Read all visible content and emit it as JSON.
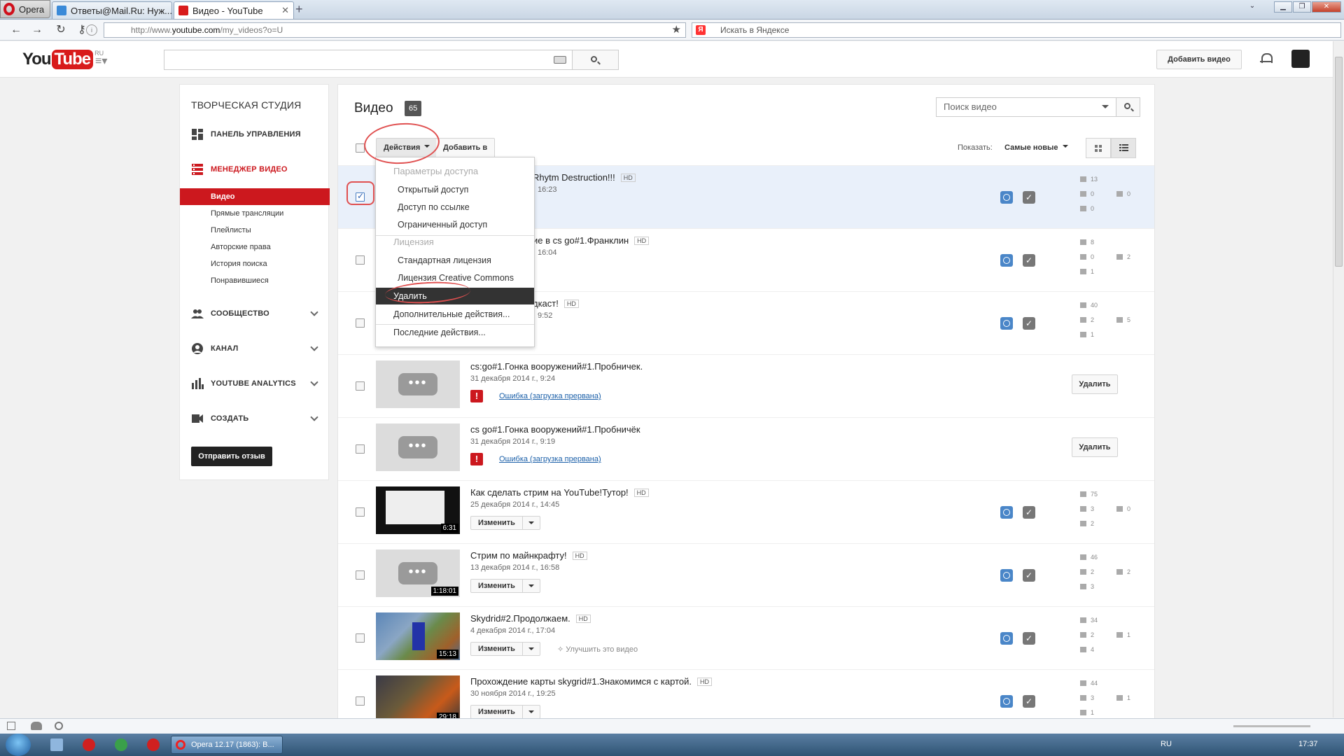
{
  "browser": {
    "opera_label": "Opera",
    "tabs": [
      {
        "label": "Ответы@Mail.Ru: Нуж..."
      },
      {
        "label": "Видео - YouTube"
      }
    ],
    "url_prefix": "http://www.",
    "url_host": "youtube.com",
    "url_path": "/my_videos?o=U",
    "search_placeholder": "Искать в Яндексе"
  },
  "header": {
    "logo_you": "You",
    "logo_tube": "Tube",
    "logo_region": "RU",
    "upload_label": "Добавить видео"
  },
  "sidebar": {
    "title": "ТВОРЧЕСКАЯ СТУДИЯ",
    "dashboard": "ПАНЕЛЬ УПРАВЛЕНИЯ",
    "video_manager": "МЕНЕДЖЕР ВИДЕО",
    "sub_items": [
      {
        "label": "Видео"
      },
      {
        "label": "Прямые трансляции"
      },
      {
        "label": "Плейлисты"
      },
      {
        "label": "Авторские права"
      },
      {
        "label": "История поиска"
      },
      {
        "label": "Понравившиеся"
      }
    ],
    "community": "СООБЩЕСТВО",
    "channel": "КАНАЛ",
    "analytics": "YOUTUBE ANALYTICS",
    "create": "СОЗДАТЬ",
    "feedback": "Отправить отзыв"
  },
  "main": {
    "title": "Видео",
    "count": "65",
    "search_placeholder": "Поиск видео",
    "actions_label": "Действия",
    "add_to_label": "Добавить в",
    "show_label": "Показать:",
    "show_value": "Самые новые"
  },
  "menu": {
    "privacy_header": "Параметры доступа",
    "public": "Открытый доступ",
    "unlisted": "Доступ по ссылке",
    "private": "Ограниченный доступ",
    "license_header": "Лицензия",
    "standard": "Стандартная лицензия",
    "cc": "Лицензия Creative Commons",
    "delete": "Удалить",
    "more": "Дополнительные действия...",
    "recent": "Последние действия..."
  },
  "videos": [
    {
      "title": "Rhytm Destruction!!!",
      "hd": "HD",
      "date": "16:23",
      "views": "13",
      "likes": "0",
      "dislikes": "0",
      "comments": "0"
    },
    {
      "title": "ие в cs go#1.Франклин",
      "hd": "HD",
      "date": "16:04",
      "views": "8",
      "likes": "0",
      "dislikes": "2",
      "comments": "1"
    },
    {
      "title": "дкаст!",
      "hd": "HD",
      "date": "9:52",
      "views": "40",
      "likes": "2",
      "dislikes": "5",
      "comments": "1"
    },
    {
      "title": "cs:go#1.Гонка вооружений#1.Пробничек.",
      "date": "31 декабря 2014 г., 9:24",
      "error": "Ошибка (загрузка прервана)",
      "delete": "Удалить"
    },
    {
      "title": "cs go#1.Гонка вооружений#1.Пробничёк",
      "date": "31 декабря 2014 г., 9:19",
      "error": "Ошибка (загрузка прервана)",
      "delete": "Удалить"
    },
    {
      "title": "Как сделать стрим на YouTube!Тутор!",
      "hd": "HD",
      "date": "25 декабря 2014 г., 14:45",
      "duration": "6:31",
      "edit": "Изменить",
      "views": "75",
      "likes": "3",
      "dislikes": "0",
      "comments": "2"
    },
    {
      "title": "Стрим по майнкрафту!",
      "hd": "HD",
      "date": "13 декабря 2014 г., 16:58",
      "duration": "1:18:01",
      "edit": "Изменить",
      "views": "46",
      "likes": "2",
      "dislikes": "2",
      "comments": "3"
    },
    {
      "title": "Skydrid#2.Продолжаем.",
      "hd": "HD",
      "date": "4 декабря 2014 г., 17:04",
      "duration": "15:13",
      "edit": "Изменить",
      "improve": "Улучшить это видео",
      "views": "34",
      "likes": "2",
      "dislikes": "1",
      "comments": "4"
    },
    {
      "title": "Прохождение карты skygrid#1.Знакомимся с картой.",
      "hd": "HD",
      "date": "30 ноября 2014 г., 19:25",
      "duration": "29:18",
      "edit": "Изменить",
      "views": "44",
      "likes": "3",
      "dislikes": "1",
      "comments": "1"
    }
  ],
  "taskbar": {
    "app_label": "Opera 12.17 (1863): В...",
    "lang": "RU",
    "clock": "17:37"
  },
  "colors": {
    "accent_red": "#cc181e",
    "annotation": "#e05050",
    "link_blue": "#1a5fa8"
  }
}
